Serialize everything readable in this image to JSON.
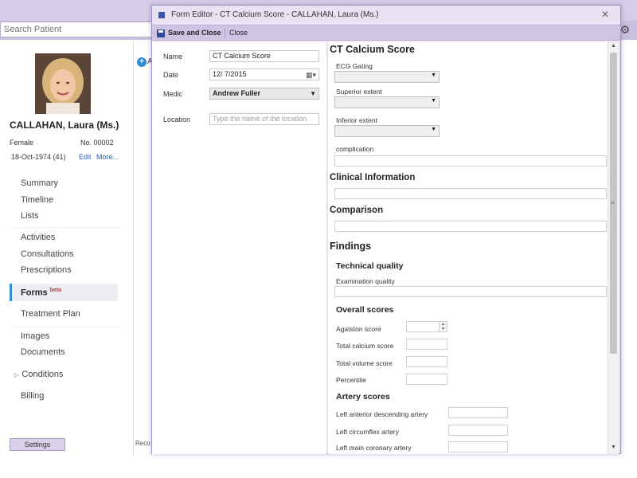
{
  "app": {
    "search_placeholder": "Search Patient",
    "patient": {
      "name": "CALLAHAN, Laura (Ms.)",
      "sex": "Female",
      "number": "No. 00002",
      "dob": "18-Oct-1974 (41)",
      "edit_link": "Edit",
      "more_link": "More..."
    },
    "nav": {
      "summary": "Summary",
      "timeline": "Timeline",
      "lists": "Lists",
      "activities": "Activities",
      "consultations": "Consultations",
      "prescriptions": "Prescriptions",
      "forms": "Forms",
      "forms_badge": "beta",
      "treatment_plan": "Treatment Plan",
      "images": "Images",
      "documents": "Documents",
      "conditions": "Conditions",
      "billing": "Billing"
    },
    "settings_label": "Settings",
    "main_add_text": "A",
    "main_bottom_text": "Reco"
  },
  "modal": {
    "title": "Form Editor - CT Calcium Score - CALLAHAN, Laura (Ms.)",
    "toolbar": {
      "save_close": "Save and Close",
      "close": "Close"
    },
    "left": {
      "name_label": "Name",
      "name_value": "CT Calcium Score",
      "date_label": "Date",
      "date_value": "12/  7/2015",
      "medic_label": "Medic",
      "medic_value": "Andrew Fuller",
      "location_label": "Location",
      "location_placeholder": "Type the name of the location"
    },
    "right": {
      "section_ct": "CT Calcium Score",
      "ecg_gating": "ECG Gating",
      "superior_extent": "Superior extent",
      "inferior_extent": "Inferior extent",
      "complication": "complication",
      "clinical_info": "Clinical Information",
      "comparison": "Comparison",
      "findings": "Findings",
      "technical_quality": "Technical quality",
      "exam_quality": "Examination quality",
      "overall_scores": "Overall scores",
      "agatston": "Agatston score",
      "total_calcium": "Total calcium score",
      "total_volume": "Total volume score",
      "percentile": "Percentile",
      "artery_scores": "Artery scores",
      "lad": "Left anterior descending artery",
      "lcx": "Left circumflex artery",
      "lmca": "Left main coronary artery"
    }
  },
  "colors": {
    "accent": "#2e8fd6",
    "chrome": "#cfc4e4",
    "titlebar": "#e8e2f2"
  }
}
